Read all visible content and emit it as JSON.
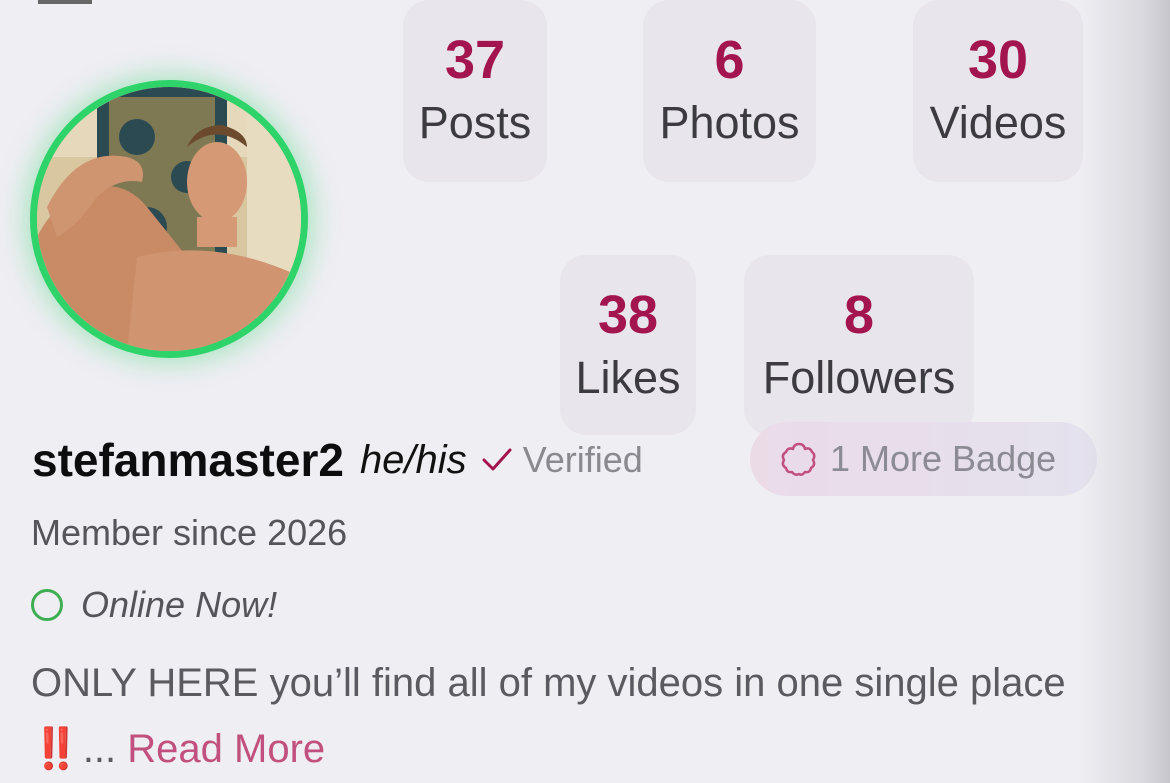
{
  "profile": {
    "username": "stefanmaster2",
    "pronouns": "he/his",
    "verified_label": "Verified",
    "member_since": "Member since 2026",
    "online_status": "Online Now!",
    "badge_label": "1 More Badge",
    "bio_text": "ONLY HERE you’ll find all of my videos in one single place",
    "bio_emoji": "‼️",
    "bio_ellipsis": "...",
    "read_more_label": "Read More",
    "avatar_ring_color": "#2ed36a"
  },
  "stats": [
    {
      "value": "37",
      "label": "Posts"
    },
    {
      "value": "6",
      "label": "Photos"
    },
    {
      "value": "30",
      "label": "Videos"
    },
    {
      "value": "38",
      "label": "Likes"
    },
    {
      "value": "8",
      "label": "Followers"
    }
  ],
  "colors": {
    "stat_number": "#a3154f",
    "read_more": "#c2507e",
    "online_dot": "#3fae52",
    "background": "#efeef3"
  },
  "icons": {
    "verified": "checkmark-icon",
    "badge": "badge-flower-icon",
    "online": "online-status-icon"
  }
}
